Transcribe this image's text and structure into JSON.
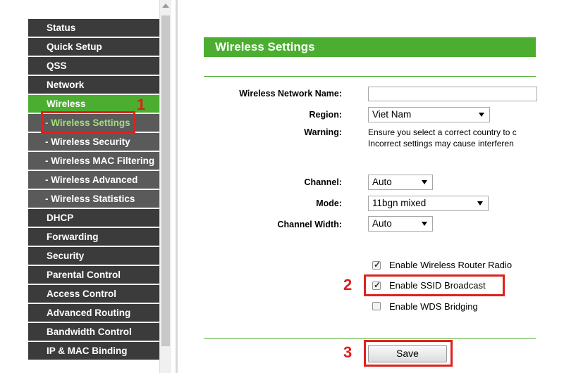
{
  "sidebar": {
    "items": [
      {
        "label": "Status"
      },
      {
        "label": "Quick Setup"
      },
      {
        "label": "QSS"
      },
      {
        "label": "Network"
      },
      {
        "label": "Wireless"
      },
      {
        "label": "- Wireless Settings"
      },
      {
        "label": "- Wireless Security"
      },
      {
        "label": "- Wireless MAC Filtering"
      },
      {
        "label": "- Wireless Advanced"
      },
      {
        "label": "- Wireless Statistics"
      },
      {
        "label": "DHCP"
      },
      {
        "label": "Forwarding"
      },
      {
        "label": "Security"
      },
      {
        "label": "Parental Control"
      },
      {
        "label": "Access Control"
      },
      {
        "label": "Advanced Routing"
      },
      {
        "label": "Bandwidth Control"
      },
      {
        "label": "IP & MAC Binding"
      }
    ]
  },
  "main": {
    "title": "Wireless Settings",
    "fields": {
      "network_name": {
        "label": "Wireless Network Name:",
        "value": ""
      },
      "region": {
        "label": "Region:",
        "value": "Viet Nam"
      },
      "warning": {
        "label": "Warning:",
        "line1": "Ensure you select a correct country to c",
        "line2": "Incorrect settings may cause interferen"
      },
      "channel": {
        "label": "Channel:",
        "value": "Auto"
      },
      "mode": {
        "label": "Mode:",
        "value": "11bgn mixed"
      },
      "channel_width": {
        "label": "Channel Width:",
        "value": "Auto"
      }
    },
    "checkboxes": [
      {
        "label": "Enable Wireless Router Radio",
        "checked": true
      },
      {
        "label": "Enable SSID Broadcast",
        "checked": true
      },
      {
        "label": "Enable WDS Bridging",
        "checked": false
      }
    ],
    "save_label": "Save"
  },
  "annotations": {
    "step1": "1",
    "step2": "2",
    "step3": "3",
    "color": "#e0201b"
  },
  "colors": {
    "accent": "#4cae31",
    "nav_bg": "#3b3b3b",
    "nav_sub_bg": "#5a5a5a",
    "selected_text": "#9fe07a"
  }
}
